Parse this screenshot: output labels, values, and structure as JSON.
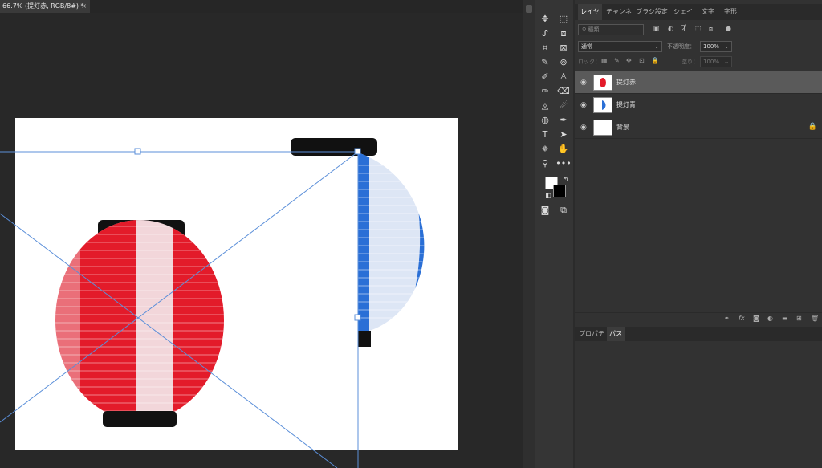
{
  "document_tab": {
    "title": "66.7% (提灯赤, RGB/8#) *",
    "close": "×"
  },
  "panel_tabs": [
    "レイヤー",
    "チャンネル",
    "ブラシ設定",
    "シェイプ",
    "文字",
    "字形"
  ],
  "filter": {
    "placeholder": "種類"
  },
  "blend": {
    "mode": "通常",
    "opacity_label": "不透明度：",
    "opacity_value": "100%"
  },
  "lock": {
    "label": "ロック：",
    "fill_label": "塗り：",
    "fill_value": "100%"
  },
  "layers": [
    {
      "name": "提灯赤",
      "selected": true
    },
    {
      "name": "提灯青",
      "selected": false
    },
    {
      "name": "背景",
      "selected": false,
      "locked": true
    }
  ],
  "props_tabs": [
    "プロパティ",
    "パス"
  ],
  "colors": {
    "accent_guide": "#5b8fd9",
    "lantern_red": "#e31b2a",
    "lantern_blue": "#2a6fd6",
    "selected_layer": "#5a5a5a"
  }
}
